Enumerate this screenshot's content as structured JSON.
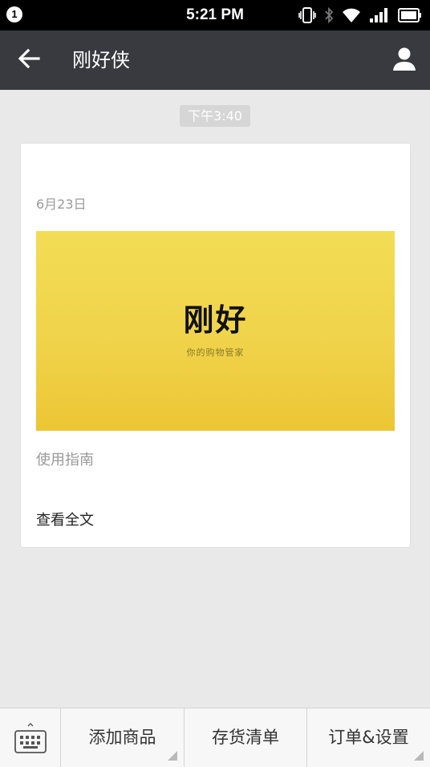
{
  "status_bar": {
    "notification_count": "1",
    "time": "5:21 PM",
    "icons": [
      "vibrate-icon",
      "bluetooth-icon",
      "wifi-icon",
      "signal-icon",
      "battery-icon"
    ]
  },
  "header": {
    "title": "刚好侠",
    "back_icon": "arrow-left-icon",
    "profile_icon": "person-icon"
  },
  "chat": {
    "timestamp": "下午3:40",
    "card": {
      "date": "6月23日",
      "cover_title": "刚好",
      "cover_subtitle": "你的购物管家",
      "description": "使用指南",
      "read_more": "查看全文"
    }
  },
  "bottom_menu": {
    "keyboard_icon": "keyboard-icon",
    "items": [
      {
        "label": "添加商品"
      },
      {
        "label": "存货清单"
      },
      {
        "label": "订单&设置"
      }
    ]
  },
  "colors": {
    "status_bar": "#000000",
    "title_bar": "#393a3f",
    "background": "#e9e9e9",
    "cover_yellow": "#f0d34a"
  }
}
